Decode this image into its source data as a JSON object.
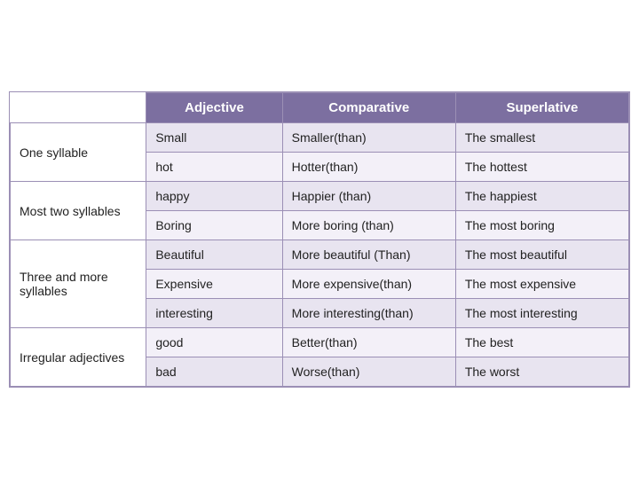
{
  "headers": {
    "col0": "",
    "col1": "Adjective",
    "col2": "Comparative",
    "col3": "Superlative"
  },
  "sections": [
    {
      "category": "One syllable",
      "rowspan": 2,
      "rows": [
        {
          "adjective": "Small",
          "comparative": "Smaller(than)",
          "superlative": "The smallest"
        },
        {
          "adjective": "hot",
          "comparative": "Hotter(than)",
          "superlative": "The hottest"
        }
      ]
    },
    {
      "category": "Most  two syllables",
      "rowspan": 2,
      "rows": [
        {
          "adjective": "happy",
          "comparative": "Happier (than)",
          "superlative": "The happiest"
        },
        {
          "adjective": "Boring",
          "comparative": "More boring (than)",
          "superlative": "The most boring"
        }
      ]
    },
    {
      "category": "Three and more syllables",
      "rowspan": 3,
      "rows": [
        {
          "adjective": "Beautiful",
          "comparative": "More beautiful (Than)",
          "superlative": "The most beautiful"
        },
        {
          "adjective": "Expensive",
          "comparative": "More expensive(than)",
          "superlative": "The most expensive"
        },
        {
          "adjective": "interesting",
          "comparative": "More interesting(than)",
          "superlative": "The most interesting"
        }
      ]
    },
    {
      "category": "Irregular adjectives",
      "rowspan": 2,
      "rows": [
        {
          "adjective": "good",
          "comparative": "Better(than)",
          "superlative": "The best"
        },
        {
          "adjective": "bad",
          "comparative": "Worse(than)",
          "superlative": "The worst"
        }
      ]
    }
  ]
}
